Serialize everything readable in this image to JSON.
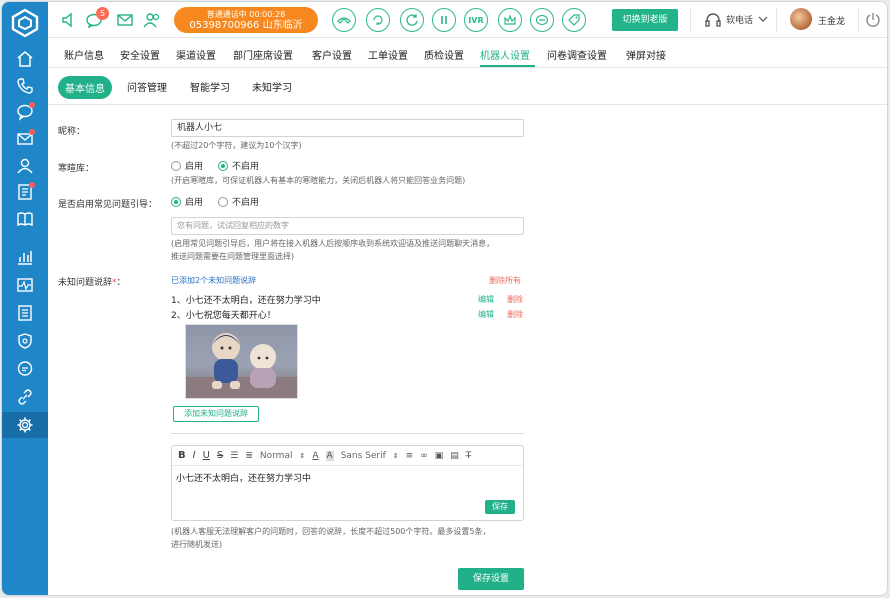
{
  "topbar": {
    "message_badge": "5",
    "call_status": "普通通话中 00:00:28",
    "call_number": "05398700966 山东临沂",
    "ivr_label": "IVR",
    "switch_label": "切换到老版",
    "softphone_label": "软电话",
    "user_name": "王金龙"
  },
  "main_tabs": [
    "账户信息",
    "安全设置",
    "渠道设置",
    "部门座席设置",
    "客户设置",
    "工单设置",
    "质检设置",
    "机器人设置",
    "问卷调查设置",
    "弹屏对接"
  ],
  "main_tab_active": "机器人设置",
  "sub_tabs": [
    "基本信息",
    "问答管理",
    "智能学习",
    "未知学习"
  ],
  "sub_tab_active": "基本信息",
  "form": {
    "nickname_label": "昵称：",
    "nickname_value": "机器人小七",
    "nickname_hint": "(不超过20个字符，建议为10个汉字)",
    "chitchat_label": "寒暄库：",
    "chitchat_opt_on": "启用",
    "chitchat_opt_off": "不启用",
    "chitchat_selected": "不启用",
    "chitchat_hint": "(开启寒暄库，可保证机器人有基本的寒暄能力，关闭后机器人将只能回答业务问题)",
    "guide_label": "是否启用常见问题引导：",
    "guide_opt_on": "启用",
    "guide_opt_off": "不启用",
    "guide_selected": "启用",
    "guide_placeholder": "您有问题，试试回复相应的数字",
    "guide_hint_1": "(启用常见问题引导后，用户将在接入机器人后按顺序收到系统欢迎语及推送问题聊天消息，",
    "guide_hint_2": "推送问题需要在问题管理里面选择)",
    "unknown_label": "未知问题说辞",
    "unknown_required": "*",
    "unknown_colon": "：",
    "unknown_count": "已添加2个未知问题说辞",
    "delete_all": "删除所有",
    "replies": [
      {
        "text": "1、小七还不太明白，还在努力学习中",
        "edit": "编辑",
        "delete": "删除"
      },
      {
        "text": "2、小七祝您每天都开心！",
        "edit": "编辑",
        "delete": "删除"
      }
    ],
    "add_reply_label": "添加未知问题说辞",
    "editor": {
      "format_label": "Normal",
      "font_label": "Sans Serif",
      "content": "小七还不太明白，还在努力学习中",
      "save_label": "保存"
    },
    "editor_hint_1": "(机器人客服无法理解客户的问题时，回答的说辞，长度不超过500个字符。最多设置5条，",
    "editor_hint_2": "进行随机发送)",
    "save_settings": "保存设置"
  }
}
